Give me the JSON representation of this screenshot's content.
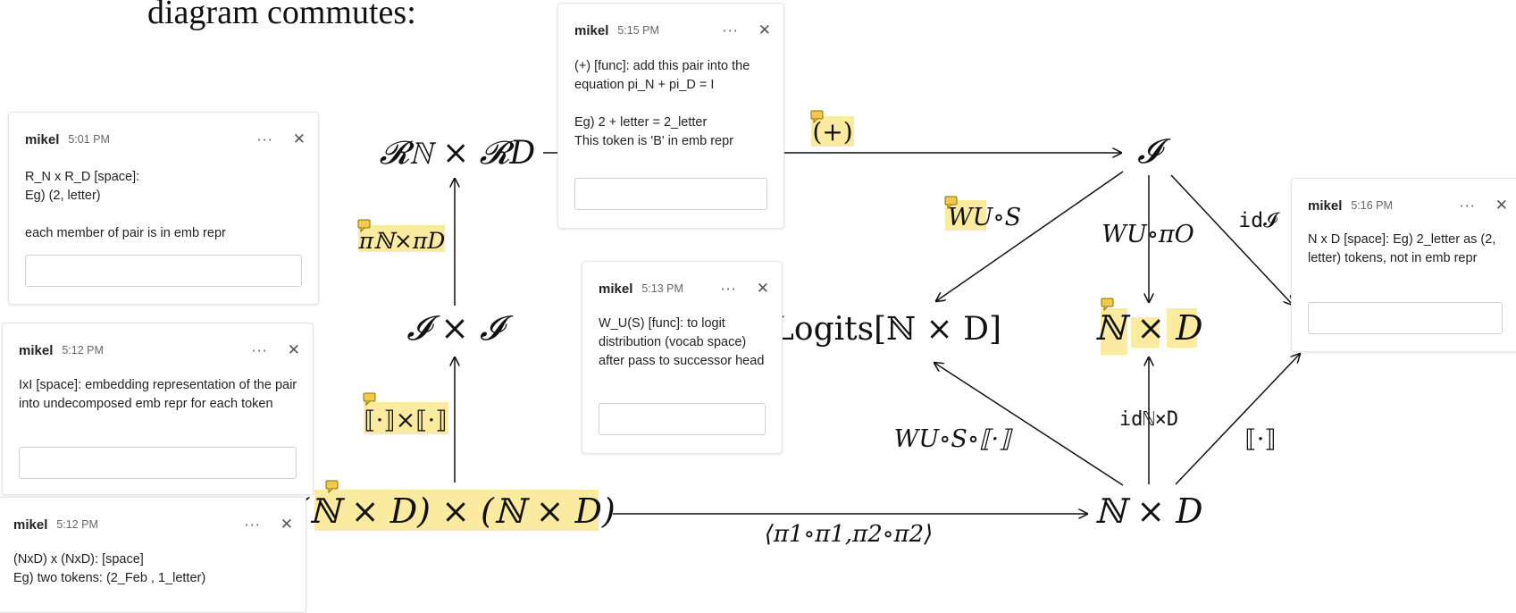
{
  "page": {
    "heading": "diagram commutes:"
  },
  "diagram": {
    "nodes": {
      "rn_rd": "𝓡ℕ × 𝓡D",
      "i_top": "𝓘",
      "i_x_i": "𝓘 × 𝓘",
      "logits": "Logits[ℕ × D]",
      "n_x_d_mid": "ℕ × D",
      "n_x_d_bottom": "ℕ × D",
      "nd_x_nd": "(ℕ × D) × (ℕ × D)"
    },
    "arrows": {
      "plus": "(+)",
      "wu_s": "WU∘S",
      "wu_pio": "WU∘πO",
      "id_i": "id𝓘",
      "pi_n_pi_d": "πℕ×πD",
      "bracket_x_bracket": "⟦·⟧×⟦·⟧",
      "wu_s_bracket": "WU∘S∘⟦·⟧",
      "id_nxd": "idℕ×D",
      "bracket": "⟦·⟧",
      "pi1_pi2": "⟨π1∘π1,π2∘π2⟩"
    }
  },
  "comments": [
    {
      "author": "mikel",
      "time": "5:01 PM",
      "body": "R_N x R_D [space]:\nEg) (2, letter)\n\neach member of pair is in emb repr"
    },
    {
      "author": "mikel",
      "time": "5:12 PM",
      "body": "IxI [space]: embedding representation of the pair into undecomposed emb repr for each token"
    },
    {
      "author": "mikel",
      "time": "5:12 PM",
      "body": "(NxD) x (NxD): [space]\nEg) two tokens: (2_Feb , 1_letter)"
    },
    {
      "author": "mikel",
      "time": "5:15 PM",
      "body": "(+) [func]: add this pair into the equation pi_N + pi_D = I\n\nEg) 2 + letter = 2_letter\nThis token is 'B' in emb repr"
    },
    {
      "author": "mikel",
      "time": "5:13 PM",
      "body": "W_U(S) [func]: to logit distribution (vocab space) after pass to successor head"
    },
    {
      "author": "mikel",
      "time": "5:16 PM",
      "body": "N x D [space]: Eg) 2_letter as (2, letter) tokens, not in emb repr"
    }
  ],
  "icons": {
    "more": "···",
    "close": "✕"
  },
  "colors": {
    "highlight": "#fbeba0",
    "comment_marker": "#f2c94c"
  }
}
